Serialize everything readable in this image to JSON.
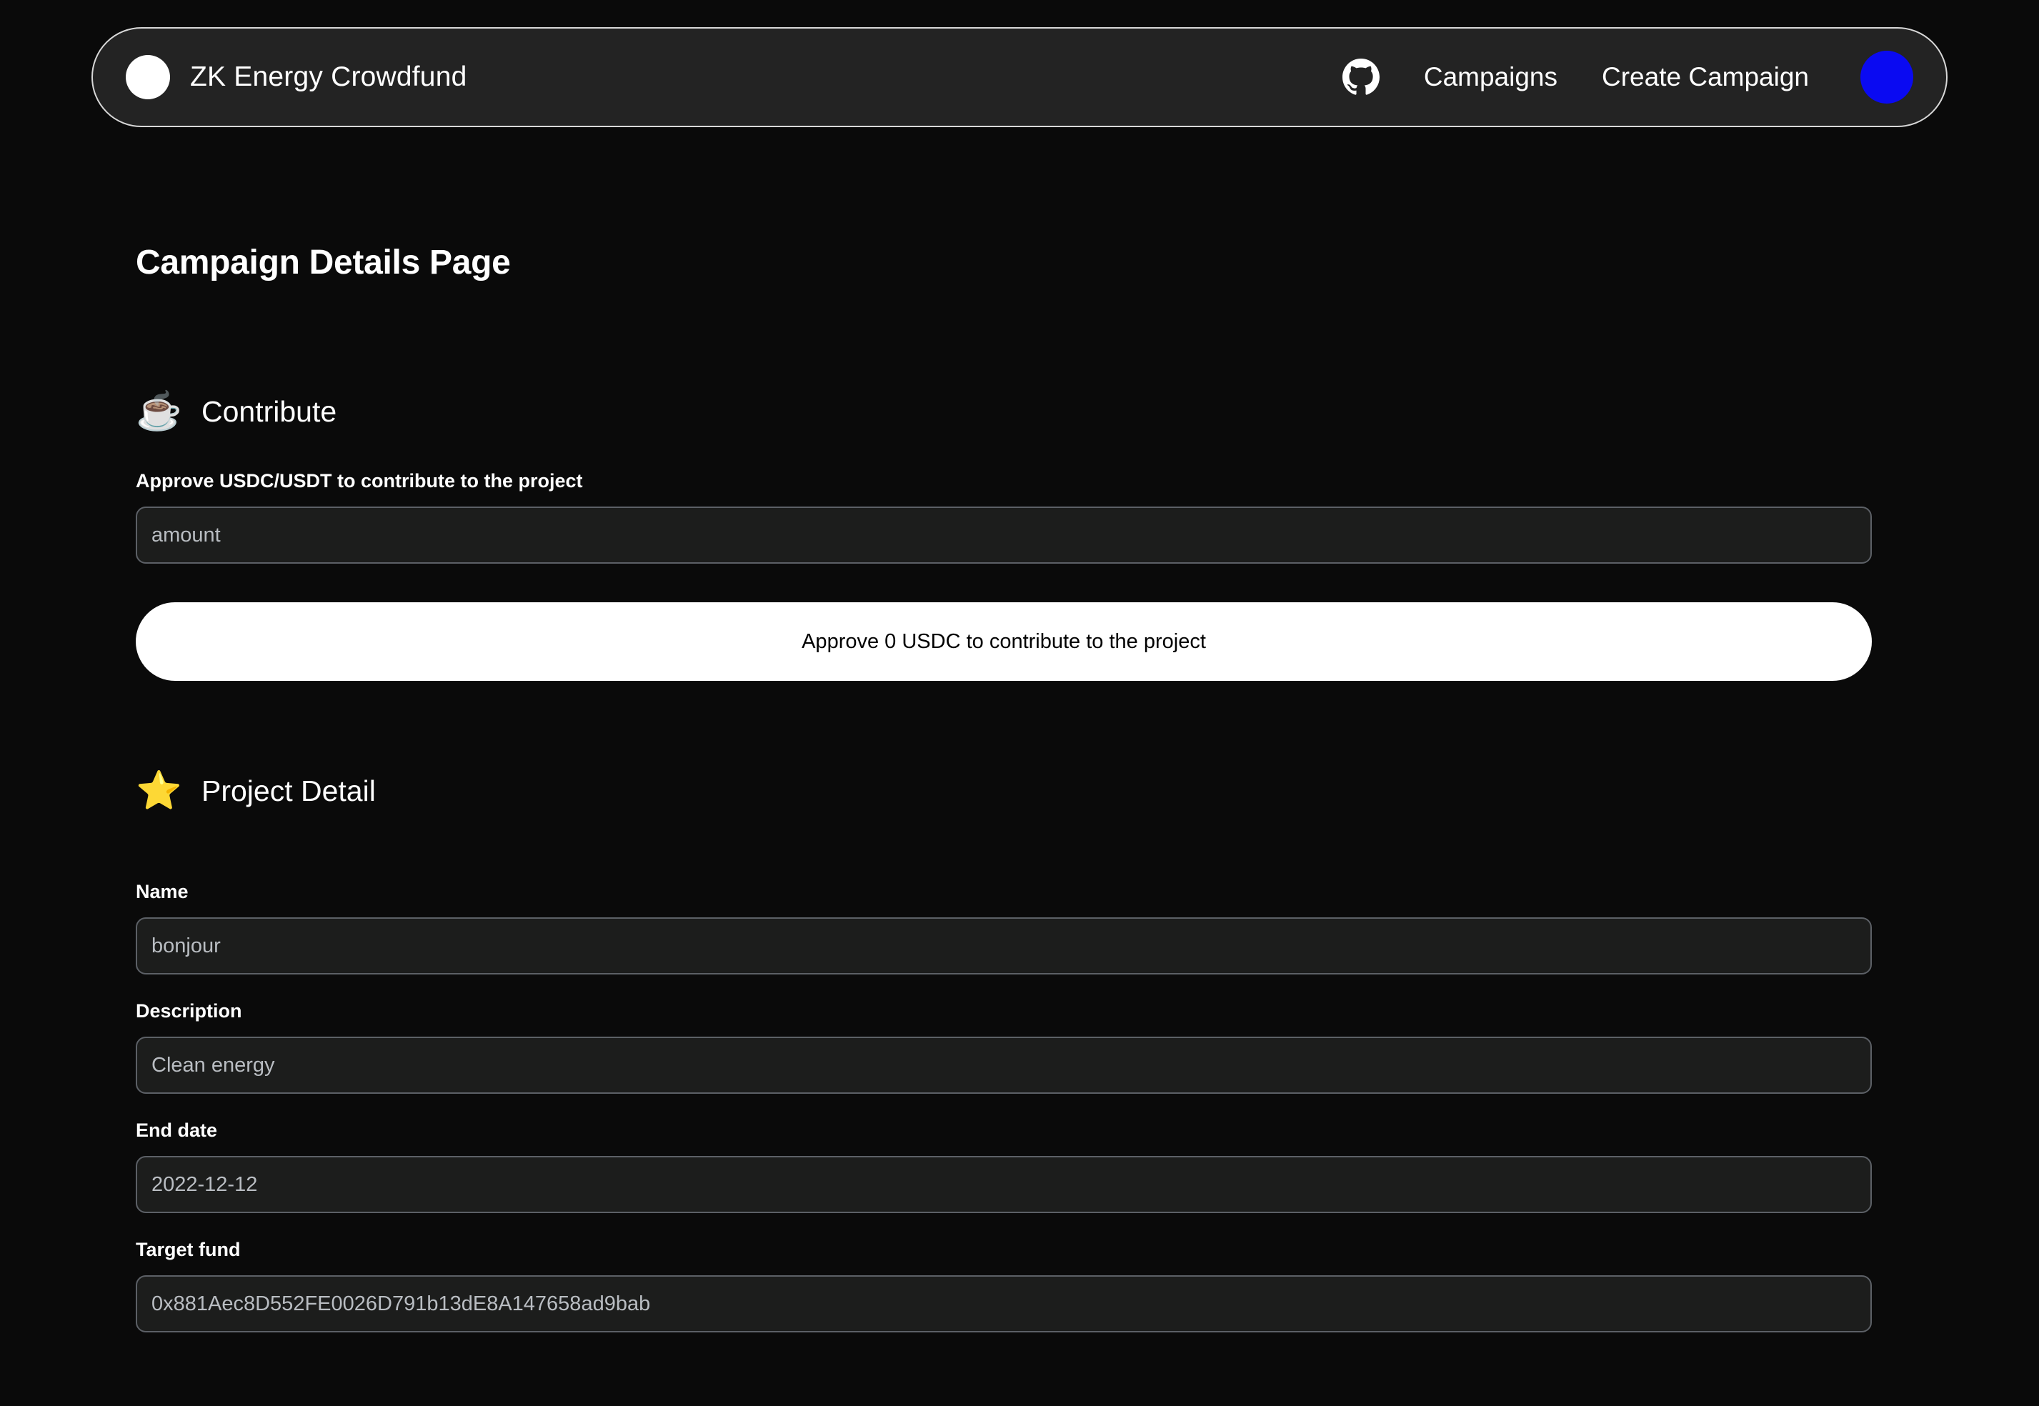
{
  "navbar": {
    "brand_title": "ZK Energy Crowdfund",
    "github_icon": "github-icon",
    "links": [
      {
        "label": "Campaigns"
      },
      {
        "label": "Create Campaign"
      }
    ],
    "avatar_color": "#0a0af2"
  },
  "page": {
    "title": "Campaign Details Page"
  },
  "contribute": {
    "emoji": "☕",
    "heading": "Contribute",
    "approve_label": "Approve USDC/USDT to contribute to the project",
    "amount_placeholder": "amount",
    "amount_value": "",
    "approve_button": "Approve 0 USDC to contribute to the project"
  },
  "project_detail": {
    "emoji": "⭐",
    "heading": "Project Detail",
    "fields": [
      {
        "label": "Name",
        "value": "bonjour"
      },
      {
        "label": "Description",
        "value": "Clean energy"
      },
      {
        "label": "End date",
        "value": "2022-12-12"
      },
      {
        "label": "Target fund",
        "value": "0x881Aec8D552FE0026D791b13dE8A147658ad9bab"
      }
    ]
  }
}
